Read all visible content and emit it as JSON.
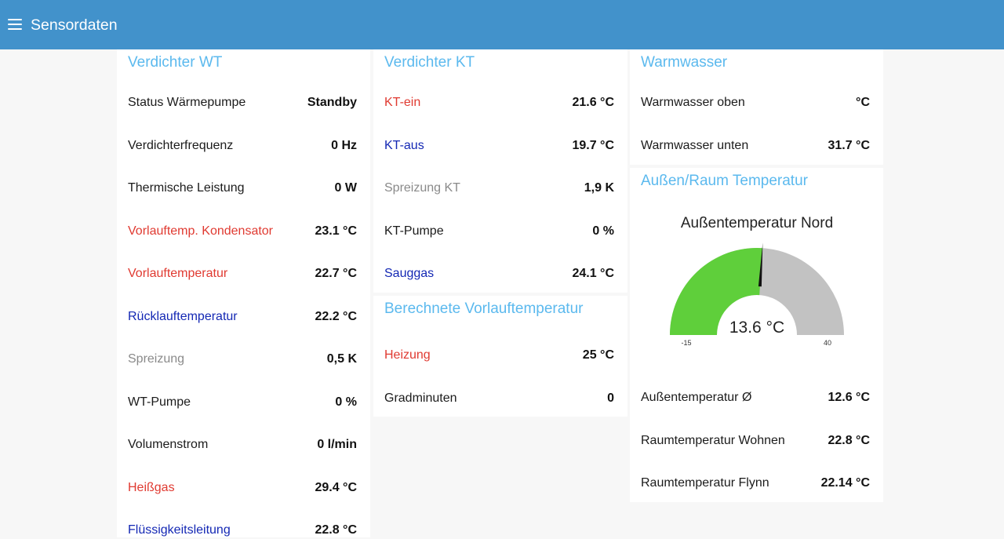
{
  "header": {
    "title": "Sensordaten",
    "colors": {
      "appbar": "#4292cb",
      "section_title": "#5bb9ee"
    }
  },
  "cards": {
    "verdichter_wt": {
      "title": "Verdichter WT",
      "rows": [
        {
          "label": "Status Wärmepumpe",
          "value": "Standby",
          "color": "black"
        },
        {
          "label": "Verdichterfrequenz",
          "value": "0 Hz",
          "color": "black"
        },
        {
          "label": "Thermische Leistung",
          "value": "0 W",
          "color": "black"
        },
        {
          "label": "Vorlauftemp. Kondensator",
          "value": "23.1 °C",
          "color": "red"
        },
        {
          "label": "Vorlauftemperatur",
          "value": "22.7 °C",
          "color": "red"
        },
        {
          "label": "Rücklauftemperatur",
          "value": "22.2 °C",
          "color": "blue"
        },
        {
          "label": "Spreizung",
          "value": "0,5 K",
          "color": "gray"
        },
        {
          "label": "WT-Pumpe",
          "value": "0 %",
          "color": "black"
        },
        {
          "label": "Volumenstrom",
          "value": "0 l/min",
          "color": "black"
        },
        {
          "label": "Heißgas",
          "value": "29.4 °C",
          "color": "red"
        },
        {
          "label": "Flüssigkeitsleitung",
          "value": "22.8 °C",
          "color": "blue"
        }
      ]
    },
    "verdichter_kt": {
      "title": "Verdichter KT",
      "rows": [
        {
          "label": "KT-ein",
          "value": "21.6 °C",
          "color": "red"
        },
        {
          "label": "KT-aus",
          "value": "19.7 °C",
          "color": "blue"
        },
        {
          "label": "Spreizung KT",
          "value": "1,9 K",
          "color": "gray"
        },
        {
          "label": "KT-Pumpe",
          "value": "0 %",
          "color": "black"
        },
        {
          "label": "Sauggas",
          "value": "24.1 °C",
          "color": "blue"
        }
      ]
    },
    "berechnete_vorlauf": {
      "title": "Berechnete Vorlauftemperatur",
      "rows": [
        {
          "label": "Heizung",
          "value": "25 °C",
          "color": "red"
        },
        {
          "label": "Gradminuten",
          "value": "0",
          "color": "black"
        }
      ]
    },
    "warmwasser": {
      "title": "Warmwasser",
      "rows": [
        {
          "label": "Warmwasser oben",
          "value": "°C",
          "color": "black"
        },
        {
          "label": "Warmwasser unten",
          "value": "31.7 °C",
          "color": "black"
        }
      ]
    },
    "aussen_raum": {
      "title": "Außen/Raum Temperatur",
      "gauge": {
        "title": "Außentemperatur Nord",
        "value": 13.6,
        "value_text": "13.6 °C",
        "min": -15,
        "max": 40,
        "min_label": "-15",
        "max_label": "40",
        "fill_color": "#5fcf3b",
        "track_color": "#c2c2c2",
        "needle_color": "#111111"
      },
      "rows": [
        {
          "label": "Außentemperatur Ø",
          "value": "12.6 °C",
          "color": "black"
        },
        {
          "label": "Raumtemperatur Wohnen",
          "value": "22.8 °C",
          "color": "black"
        },
        {
          "label": "Raumtemperatur Flynn",
          "value": "22.14 °C",
          "color": "black"
        }
      ]
    }
  }
}
